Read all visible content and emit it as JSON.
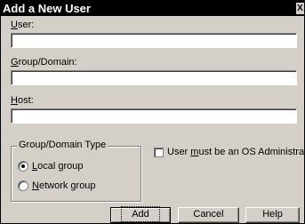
{
  "window": {
    "title": "Add a New User",
    "close_glyph": "X"
  },
  "user_field": {
    "label_mnemonic": "U",
    "label_rest": "ser:",
    "value": ""
  },
  "group_field": {
    "label_mnemonic": "G",
    "label_rest": "roup/Domain:",
    "value": ""
  },
  "host_field": {
    "label_mnemonic": "H",
    "label_rest": "ost:",
    "value": ""
  },
  "group_type": {
    "legend": "Group/Domain Type",
    "local": {
      "mnemonic": "L",
      "rest": "ocal group",
      "selected": true
    },
    "network": {
      "mnemonic": "N",
      "rest": "etwork group",
      "selected": false
    }
  },
  "os_admin": {
    "label_before": "User ",
    "label_mnemonic": "m",
    "label_after": "ust be an OS Administrator",
    "checked": false
  },
  "buttons": {
    "add": "Add",
    "cancel": "Cancel",
    "help": "Help"
  },
  "colors": {
    "face": "#d4d0c8",
    "title_bar": "#000000",
    "title_text": "#ffffff",
    "field": "#ffffff"
  }
}
